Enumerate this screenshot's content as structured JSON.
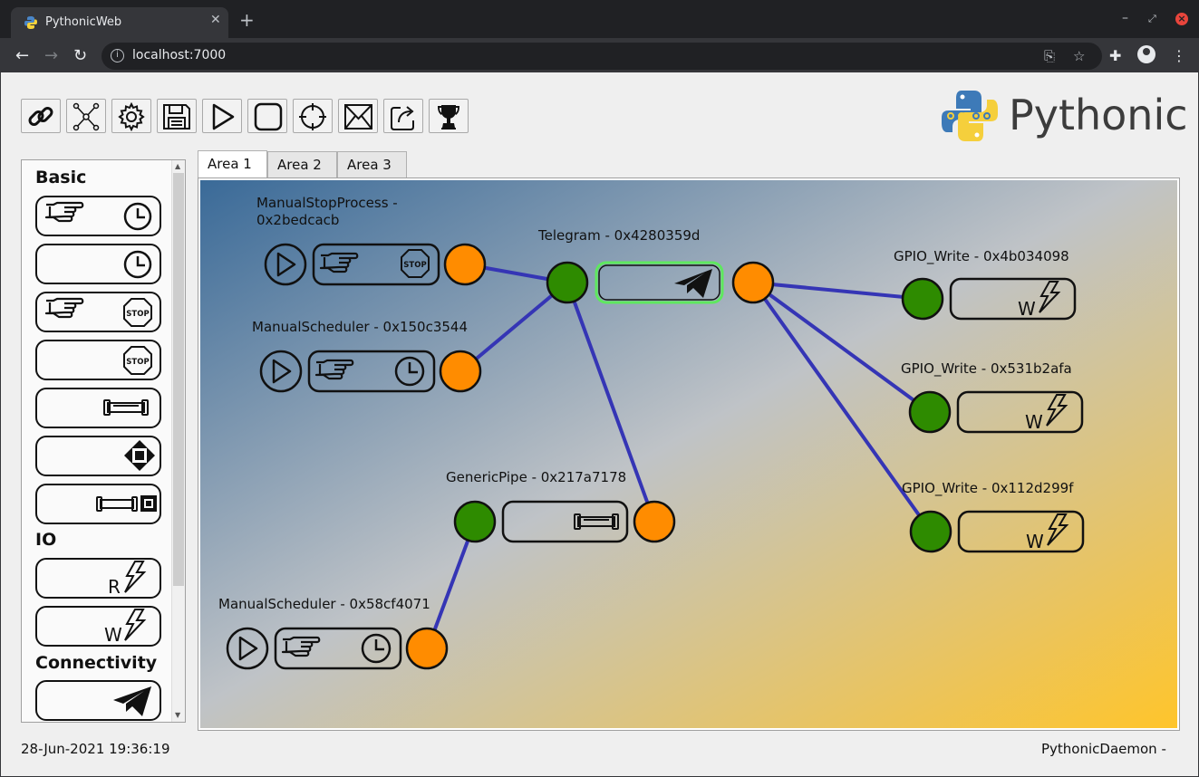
{
  "browser": {
    "tab_title": "PythonicWeb",
    "url": "localhost:7000"
  },
  "toolbar_icons": [
    "link-icon",
    "network-icon",
    "gear-icon",
    "save-icon",
    "play-icon",
    "stop-icon",
    "target-icon",
    "envelope-icon",
    "share-icon",
    "trophy-icon"
  ],
  "logo_text": "Pythonic",
  "sidebar": {
    "categories": [
      {
        "label": "Basic"
      },
      {
        "label": "IO"
      },
      {
        "label": "Connectivity"
      }
    ],
    "gpio_read_letter": "R",
    "gpio_write_letter": "W"
  },
  "area_tabs": [
    "Area 1",
    "Area 2",
    "Area 3"
  ],
  "canvas": {
    "nodes": [
      {
        "label": "ManualStopProcess -\n0x2bedcacb"
      },
      {
        "label": "ManualScheduler - 0x150c3544"
      },
      {
        "label": "Telegram - 0x4280359d"
      },
      {
        "label": "GenericPipe - 0x217a7178"
      },
      {
        "label": "ManualScheduler - 0x58cf4071"
      },
      {
        "label": "GPIO_Write - 0x4b034098"
      },
      {
        "label": "GPIO_Write - 0x531b2afa"
      },
      {
        "label": "GPIO_Write - 0x112d299f"
      }
    ],
    "write_letter": "W",
    "stop_text": "STOP"
  },
  "status": {
    "datetime": "28-Jun-2021 19:36:19",
    "daemon": "PythonicDaemon -"
  },
  "colors": {
    "input_port": "#2e8b00",
    "output_port": "#ff8c00",
    "link": "#3535b5",
    "selected_border": "#5ee85e"
  }
}
